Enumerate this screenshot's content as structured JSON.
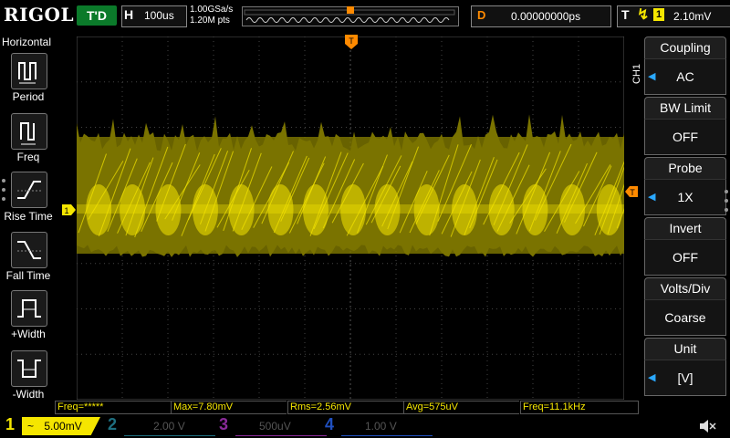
{
  "top": {
    "logo": "RIGOL",
    "run_status": "T'D",
    "timebase_label": "H",
    "timebase_value": "100us",
    "sample_rate": "1.00GSa/s",
    "memory_depth": "1.20M pts",
    "delay_label": "D",
    "delay_value": "0.00000000ps",
    "trigger_label": "T",
    "trigger_source": "1",
    "trigger_level": "2.10mV"
  },
  "left_panel": {
    "title": "Horizontal",
    "buttons": [
      {
        "label": "Period"
      },
      {
        "label": "Freq"
      },
      {
        "label": "Rise Time"
      },
      {
        "label": "Fall Time"
      },
      {
        "label": "+Width"
      },
      {
        "label": "-Width"
      }
    ]
  },
  "ch1_marker": "1",
  "trigger_marker": "T",
  "right_panel": {
    "channel_tag": "CH1",
    "items": [
      {
        "title": "Coupling",
        "value": "AC"
      },
      {
        "title": "BW Limit",
        "value": "OFF"
      },
      {
        "title": "Probe",
        "value": "1X"
      },
      {
        "title": "Invert",
        "value": "OFF"
      },
      {
        "title": "Volts/Div",
        "value": "Coarse"
      },
      {
        "title": "Unit",
        "value": "[V]"
      }
    ]
  },
  "measurements": [
    {
      "text": "Freq=*****"
    },
    {
      "text": "Max=7.80mV"
    },
    {
      "text": "Rms=2.56mV"
    },
    {
      "text": "Avg=575uV"
    },
    {
      "text": "Freq=11.1kHz"
    }
  ],
  "channels": [
    {
      "num": "1",
      "coupling": "~",
      "scale": "5.00mV",
      "color": "#f5e600"
    },
    {
      "num": "2",
      "coupling": "",
      "scale": "2.00 V",
      "color": "#00c8ff"
    },
    {
      "num": "3",
      "coupling": "",
      "scale": "500uV",
      "color": "#e040ff"
    },
    {
      "num": "4",
      "coupling": "",
      "scale": "1.00 V",
      "color": "#2060ff"
    }
  ],
  "colors": {
    "ch1": "#f5e600",
    "trigger": "#ff8a00",
    "accent": "#2aa8ff"
  }
}
